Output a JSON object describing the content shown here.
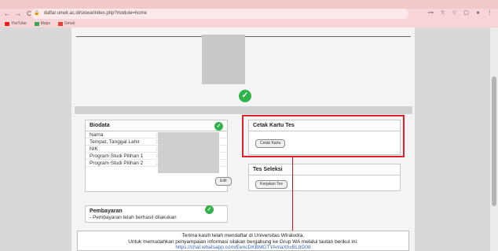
{
  "browser": {
    "url": "daftar.unwir.ac.id/siswa/index.php?module=home",
    "bookmarks": [
      {
        "label": "YouTube",
        "icon": "youtube-icon"
      },
      {
        "label": "Maps",
        "icon": "maps-icon"
      },
      {
        "label": "Gmail",
        "icon": "gmail-icon"
      }
    ]
  },
  "biodata": {
    "title": "Biodata",
    "rows": [
      {
        "label": "Nama",
        "sep": ":"
      },
      {
        "label": "Tempat, Tanggal Lahir",
        "sep": ":"
      },
      {
        "label": "NIK",
        "sep": ":"
      },
      {
        "label": "Program Studi Pilihan 1",
        "sep": ":"
      },
      {
        "label": "Program Studi Pilihan 2",
        "sep": ":"
      }
    ],
    "edit_label": "Edit"
  },
  "pembayaran": {
    "title": "Pembayaran",
    "status": "- Pembayaran telah berhasil dilakukan"
  },
  "cetak_kartu": {
    "title": "Cetak Kartu Tes",
    "button_label": "Cetak Kartu"
  },
  "tes_seleksi": {
    "title": "Tes Seleksi",
    "button_label": "Kerjakan Tes"
  },
  "notice": {
    "line1": "Terima kasih telah mendaftar di Universitas Wiralodra.",
    "line2": "Untuk memudahkan penyampaian informasi silakan bergabung ke Grup WA melalui tautan berikut ini:",
    "link": "https://chat.whatsapp.com/EencDKBMGTYAmaXhxBL8G08"
  },
  "colors": {
    "accent_green": "#32b24a",
    "highlight_red": "#e0202a",
    "link_blue": "#3a66c4"
  }
}
